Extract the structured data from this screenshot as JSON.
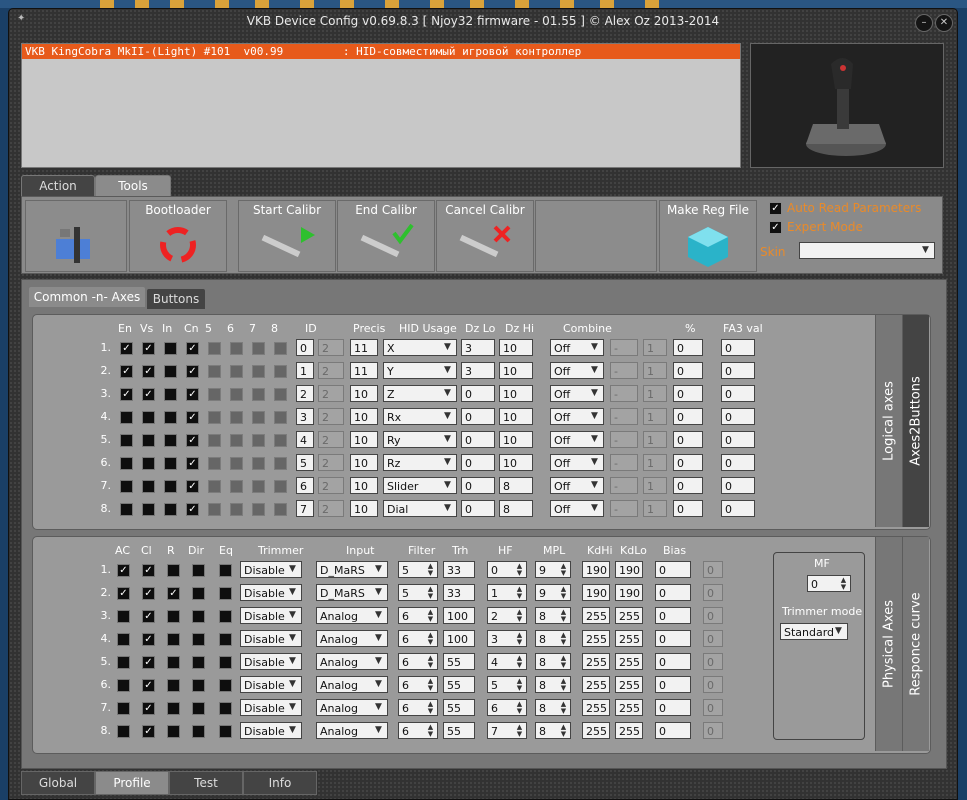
{
  "window": {
    "title": "VKB Device Config v0.69.8.3 [ Njoy32 firmware - 01.55 ] © Alex Oz 2013-2014",
    "close_glyph": "✕",
    "min_glyph": "–"
  },
  "device_list": [
    {
      "text": "VKB KingCobra MkII-(Light) #101  v00.99         : HID-совместимый игровой контроллер"
    }
  ],
  "device_preview_icon": "joystick-icon",
  "main_tabs": [
    {
      "label": "Action"
    },
    {
      "label": "Tools"
    }
  ],
  "toolbar": {
    "buttons": [
      {
        "label": "",
        "icon": "tools-icon"
      },
      {
        "label": "Bootloader",
        "icon": "recycle-icon"
      },
      {
        "label": "Start Calibr",
        "icon": "caliper-play-icon"
      },
      {
        "label": "End Calibr",
        "icon": "caliper-check-icon"
      },
      {
        "label": "Cancel Calibr",
        "icon": "caliper-cancel-icon"
      },
      {
        "label": "",
        "icon": ""
      },
      {
        "label": "Make Reg File",
        "icon": "registry-cube-icon"
      }
    ],
    "auto_read": {
      "label": "Auto Read Parameters",
      "checked": true
    },
    "expert_mode": {
      "label": "Expert Mode",
      "checked": true
    },
    "skin_label": "Skin",
    "skin_value": ""
  },
  "sub_tabs": [
    {
      "label": "Common -n- Axes"
    },
    {
      "label": "Buttons"
    }
  ],
  "logical": {
    "vtab_active": "Logical axes",
    "vtab_other": "Axes2Buttons",
    "headers": {
      "en": "En",
      "vs": "Vs",
      "in": "In",
      "cn": "Cn",
      "c5": "5",
      "c6": "6",
      "c7": "7",
      "c8": "8",
      "id": "ID",
      "precis": "Precis",
      "hid": "HID Usage",
      "dzlo": "Dz Lo",
      "dzhi": "Dz Hi",
      "combine": "Combine",
      "pct": "%",
      "fa3": "FA3 val"
    },
    "rows": [
      {
        "n": "1.",
        "en": true,
        "vs": true,
        "in": false,
        "cn": true,
        "id": "0",
        "id2": "2",
        "precis": "11",
        "hid": "X",
        "dzlo": "3",
        "dzhi": "10",
        "combine": "Off",
        "c2": "-",
        "c3": "1",
        "pct": "0",
        "fa3": "0"
      },
      {
        "n": "2.",
        "en": true,
        "vs": true,
        "in": false,
        "cn": true,
        "id": "1",
        "id2": "2",
        "precis": "11",
        "hid": "Y",
        "dzlo": "3",
        "dzhi": "10",
        "combine": "Off",
        "c2": "-",
        "c3": "1",
        "pct": "0",
        "fa3": "0"
      },
      {
        "n": "3.",
        "en": true,
        "vs": true,
        "in": false,
        "cn": true,
        "id": "2",
        "id2": "2",
        "precis": "10",
        "hid": "Z",
        "dzlo": "0",
        "dzhi": "10",
        "combine": "Off",
        "c2": "-",
        "c3": "1",
        "pct": "0",
        "fa3": "0"
      },
      {
        "n": "4.",
        "en": false,
        "vs": false,
        "in": false,
        "cn": true,
        "id": "3",
        "id2": "2",
        "precis": "10",
        "hid": "Rx",
        "dzlo": "0",
        "dzhi": "10",
        "combine": "Off",
        "c2": "-",
        "c3": "1",
        "pct": "0",
        "fa3": "0"
      },
      {
        "n": "5.",
        "en": false,
        "vs": false,
        "in": false,
        "cn": true,
        "id": "4",
        "id2": "2",
        "precis": "10",
        "hid": "Ry",
        "dzlo": "0",
        "dzhi": "10",
        "combine": "Off",
        "c2": "-",
        "c3": "1",
        "pct": "0",
        "fa3": "0"
      },
      {
        "n": "6.",
        "en": false,
        "vs": false,
        "in": false,
        "cn": true,
        "id": "5",
        "id2": "2",
        "precis": "10",
        "hid": "Rz",
        "dzlo": "0",
        "dzhi": "10",
        "combine": "Off",
        "c2": "-",
        "c3": "1",
        "pct": "0",
        "fa3": "0"
      },
      {
        "n": "7.",
        "en": false,
        "vs": false,
        "in": false,
        "cn": true,
        "id": "6",
        "id2": "2",
        "precis": "10",
        "hid": "Slider",
        "dzlo": "0",
        "dzhi": "8",
        "combine": "Off",
        "c2": "-",
        "c3": "1",
        "pct": "0",
        "fa3": "0"
      },
      {
        "n": "8.",
        "en": false,
        "vs": false,
        "in": false,
        "cn": true,
        "id": "7",
        "id2": "2",
        "precis": "10",
        "hid": "Dial",
        "dzlo": "0",
        "dzhi": "8",
        "combine": "Off",
        "c2": "-",
        "c3": "1",
        "pct": "0",
        "fa3": "0"
      }
    ]
  },
  "physical": {
    "vtab_active": "Physical Axes",
    "vtab_other": "Responce curve",
    "headers": {
      "ac": "AC",
      "cl": "Cl",
      "r": "R",
      "dir": "Dir",
      "eq": "Eq",
      "trimmer": "Trimmer",
      "input": "Input",
      "filter": "Filter",
      "trh": "Trh",
      "hf": "HF",
      "mpl": "MPL",
      "kdhi": "KdHi",
      "kdlo": "KdLo",
      "bias": "Bias"
    },
    "rows": [
      {
        "n": "1.",
        "ac": true,
        "cl": true,
        "r": false,
        "dir": false,
        "eq": false,
        "trimmer": "Disable",
        "input": "D_MaRS",
        "filter": "5",
        "trh": "33",
        "hf": "0",
        "mpl": "9",
        "kdhi": "190",
        "kdlo": "190",
        "bias": "0"
      },
      {
        "n": "2.",
        "ac": true,
        "cl": true,
        "r": true,
        "dir": false,
        "eq": false,
        "trimmer": "Disable",
        "input": "D_MaRS",
        "filter": "5",
        "trh": "33",
        "hf": "1",
        "mpl": "9",
        "kdhi": "190",
        "kdlo": "190",
        "bias": "0"
      },
      {
        "n": "3.",
        "ac": false,
        "cl": true,
        "r": false,
        "dir": false,
        "eq": false,
        "trimmer": "Disable",
        "input": "Analog",
        "filter": "6",
        "trh": "100",
        "hf": "2",
        "mpl": "8",
        "kdhi": "255",
        "kdlo": "255",
        "bias": "0"
      },
      {
        "n": "4.",
        "ac": false,
        "cl": true,
        "r": false,
        "dir": false,
        "eq": false,
        "trimmer": "Disable",
        "input": "Analog",
        "filter": "6",
        "trh": "100",
        "hf": "3",
        "mpl": "8",
        "kdhi": "255",
        "kdlo": "255",
        "bias": "0"
      },
      {
        "n": "5.",
        "ac": false,
        "cl": true,
        "r": false,
        "dir": false,
        "eq": false,
        "trimmer": "Disable",
        "input": "Analog",
        "filter": "6",
        "trh": "55",
        "hf": "4",
        "mpl": "8",
        "kdhi": "255",
        "kdlo": "255",
        "bias": "0"
      },
      {
        "n": "6.",
        "ac": false,
        "cl": true,
        "r": false,
        "dir": false,
        "eq": false,
        "trimmer": "Disable",
        "input": "Analog",
        "filter": "6",
        "trh": "55",
        "hf": "5",
        "mpl": "8",
        "kdhi": "255",
        "kdlo": "255",
        "bias": "0"
      },
      {
        "n": "7.",
        "ac": false,
        "cl": true,
        "r": false,
        "dir": false,
        "eq": false,
        "trimmer": "Disable",
        "input": "Analog",
        "filter": "6",
        "trh": "55",
        "hf": "6",
        "mpl": "8",
        "kdhi": "255",
        "kdlo": "255",
        "bias": "0"
      },
      {
        "n": "8.",
        "ac": false,
        "cl": true,
        "r": false,
        "dir": false,
        "eq": false,
        "trimmer": "Disable",
        "input": "Analog",
        "filter": "6",
        "trh": "55",
        "hf": "7",
        "mpl": "8",
        "kdhi": "255",
        "kdlo": "255",
        "bias": "0"
      }
    ],
    "mf": {
      "label": "MF",
      "value": "0",
      "trimmer_mode_label": "Trimmer mode",
      "trimmer_mode_value": "Standard"
    }
  },
  "bottom_tabs": [
    {
      "label": "Global"
    },
    {
      "label": "Profile"
    },
    {
      "label": "Test"
    },
    {
      "label": "Info"
    }
  ]
}
